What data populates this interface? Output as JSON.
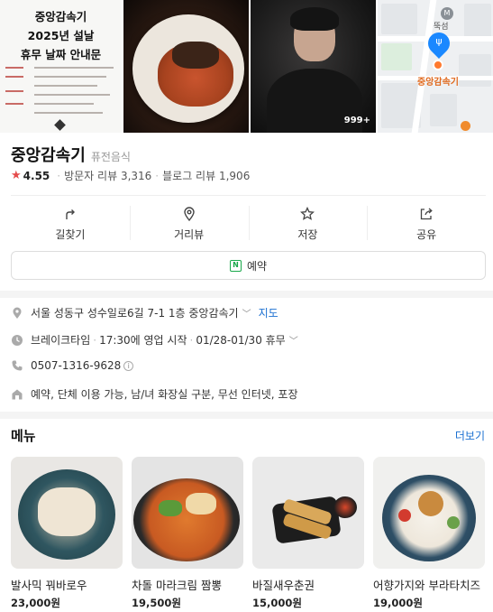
{
  "photos": {
    "notice": {
      "title_lines": [
        "중앙감속기",
        "2025년 설날",
        "휴무 날짜 안내문"
      ]
    },
    "chef_more_count": "999+",
    "map": {
      "station_label": "뚝섬",
      "place_label": "중앙감속기"
    }
  },
  "place": {
    "name": "중앙감속기",
    "category": "퓨전음식",
    "rating": "4.55",
    "visitor_reviews_label": "방문자 리뷰",
    "visitor_reviews_count": "3,316",
    "blog_reviews_label": "블로그 리뷰",
    "blog_reviews_count": "1,906"
  },
  "actions": [
    {
      "label": "길찾기",
      "icon": "directions-icon"
    },
    {
      "label": "거리뷰",
      "icon": "street-view-icon"
    },
    {
      "label": "저장",
      "icon": "star-outline-icon"
    },
    {
      "label": "공유",
      "icon": "share-icon"
    }
  ],
  "reserve": {
    "label": "예약",
    "icon": "naver-n-icon",
    "color": "#19a84a"
  },
  "info": {
    "address": "서울 성동구 성수일로6길 7-1 1층 중앙감속기",
    "map_link": "지도",
    "hours_status": "브레이크타임",
    "hours_detail": "17:30에 영업 시작",
    "holiday": "01/28-01/30 휴무",
    "phone": "0507-1316-9628",
    "amenities": "예약, 단체 이용 가능, 남/녀 화장실 구분, 무선 인터넷, 포장"
  },
  "menu": {
    "title": "메뉴",
    "more_label": "더보기",
    "items": [
      {
        "name": "발사믹 꿔바로우",
        "price": "23,000원"
      },
      {
        "name": "차돌 마라크림 짬뽕",
        "price": "19,500원"
      },
      {
        "name": "바질새우춘권",
        "price": "15,000원"
      },
      {
        "name": "어향가지와 부라타치즈",
        "price": "19,000원"
      }
    ]
  },
  "colors": {
    "accent_blue": "#1a6fd1",
    "star_red": "#e54b4b",
    "map_pin_blue": "#1a88ff",
    "map_place_orange": "#e06a1f"
  }
}
